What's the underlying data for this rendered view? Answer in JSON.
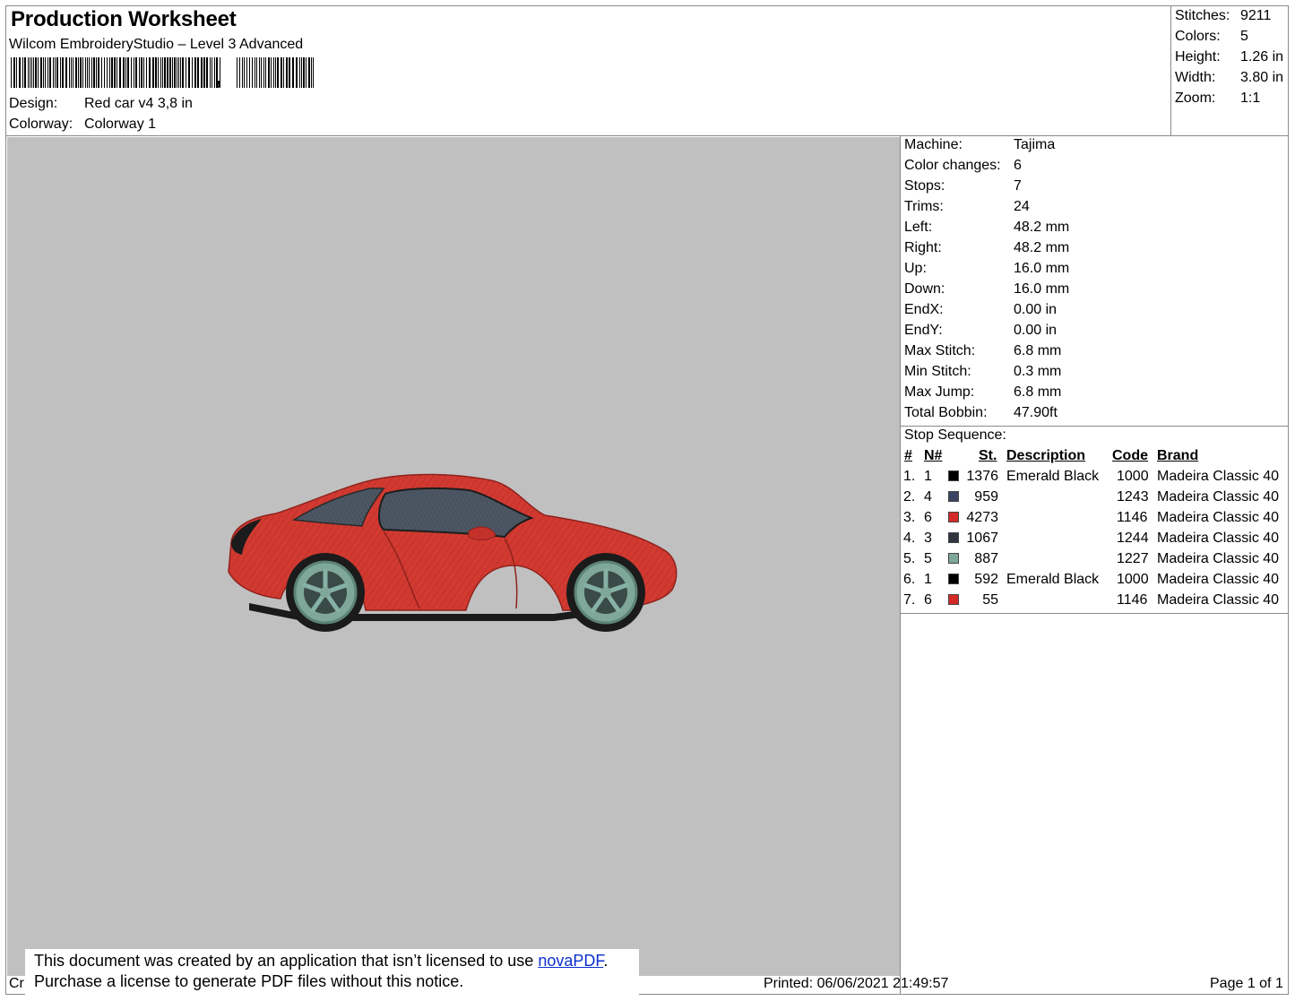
{
  "header": {
    "title": "Production Worksheet",
    "subtitle": "Wilcom EmbroideryStudio – Level 3 Advanced",
    "barcode_comma": ",",
    "design_label": "Design:",
    "design_value": "Red car v4 3,8 in",
    "colorway_label": "Colorway:",
    "colorway_value": "Colorway 1"
  },
  "header_stats": [
    {
      "label": "Stitches:",
      "value": "9211"
    },
    {
      "label": "Colors:",
      "value": "5"
    },
    {
      "label": "Height:",
      "value": "1.26 in"
    },
    {
      "label": "Width:",
      "value": "3.80 in"
    },
    {
      "label": "Zoom:",
      "value": "1:1"
    }
  ],
  "machine_stats": [
    {
      "label": "Machine:",
      "value": "Tajima"
    },
    {
      "label": "Color changes:",
      "value": "6"
    },
    {
      "label": "Stops:",
      "value": "7"
    },
    {
      "label": "Trims:",
      "value": "24"
    },
    {
      "label": "Left:",
      "value": "48.2 mm"
    },
    {
      "label": "Right:",
      "value": "48.2 mm"
    },
    {
      "label": "Up:",
      "value": "16.0 mm"
    },
    {
      "label": "Down:",
      "value": "16.0 mm"
    },
    {
      "label": "EndX:",
      "value": "0.00 in"
    },
    {
      "label": "EndY:",
      "value": "0.00 in"
    },
    {
      "label": "Max Stitch:",
      "value": "6.8 mm"
    },
    {
      "label": "Min Stitch:",
      "value": "0.3 mm"
    },
    {
      "label": "Max Jump:",
      "value": "6.8 mm"
    },
    {
      "label": "Total Bobbin:",
      "value": "47.90ft"
    }
  ],
  "stop_sequence": {
    "title": "Stop Sequence:",
    "headers": {
      "num": "#",
      "needle": "N#",
      "stitches": "St.",
      "description": "Description",
      "code": "Code",
      "brand": "Brand"
    },
    "rows": [
      {
        "num": "1.",
        "needle": "1",
        "color": "#000000",
        "stitches": "1376",
        "description": "Emerald Black",
        "code": "1000",
        "brand": "Madeira Classic 40"
      },
      {
        "num": "2.",
        "needle": "4",
        "color": "#3c4463",
        "stitches": "959",
        "description": "",
        "code": "1243",
        "brand": "Madeira Classic 40"
      },
      {
        "num": "3.",
        "needle": "6",
        "color": "#d42a27",
        "stitches": "4273",
        "description": "",
        "code": "1146",
        "brand": "Madeira Classic 40"
      },
      {
        "num": "4.",
        "needle": "3",
        "color": "#2f3440",
        "stitches": "1067",
        "description": "",
        "code": "1244",
        "brand": "Madeira Classic 40"
      },
      {
        "num": "5.",
        "needle": "5",
        "color": "#7fa79a",
        "stitches": "887",
        "description": "",
        "code": "1227",
        "brand": "Madeira Classic 40"
      },
      {
        "num": "6.",
        "needle": "1",
        "color": "#000000",
        "stitches": "592",
        "description": "Emerald Black",
        "code": "1000",
        "brand": "Madeira Classic 40"
      },
      {
        "num": "7.",
        "needle": "6",
        "color": "#d42a27",
        "stitches": "55",
        "description": "",
        "code": "1146",
        "brand": "Madeira Classic 40"
      }
    ]
  },
  "notice": {
    "line1_prefix": "This document was created by an application that isn’t licensed to use ",
    "link": "novaPDF",
    "line1_suffix": ".",
    "line2": "Purchase a license to generate PDF files without this notice."
  },
  "footer": {
    "left_fragment": "Cr",
    "printed": "Printed: 06/06/2021 21:49:57",
    "page": "Page 1 of 1"
  },
  "colors": {
    "canvas_bg": "#c0c0c0",
    "car_body": "#d23a31",
    "glass": "#4d5764",
    "wheel": "#6f9d90",
    "link": "#0b2fd0"
  }
}
